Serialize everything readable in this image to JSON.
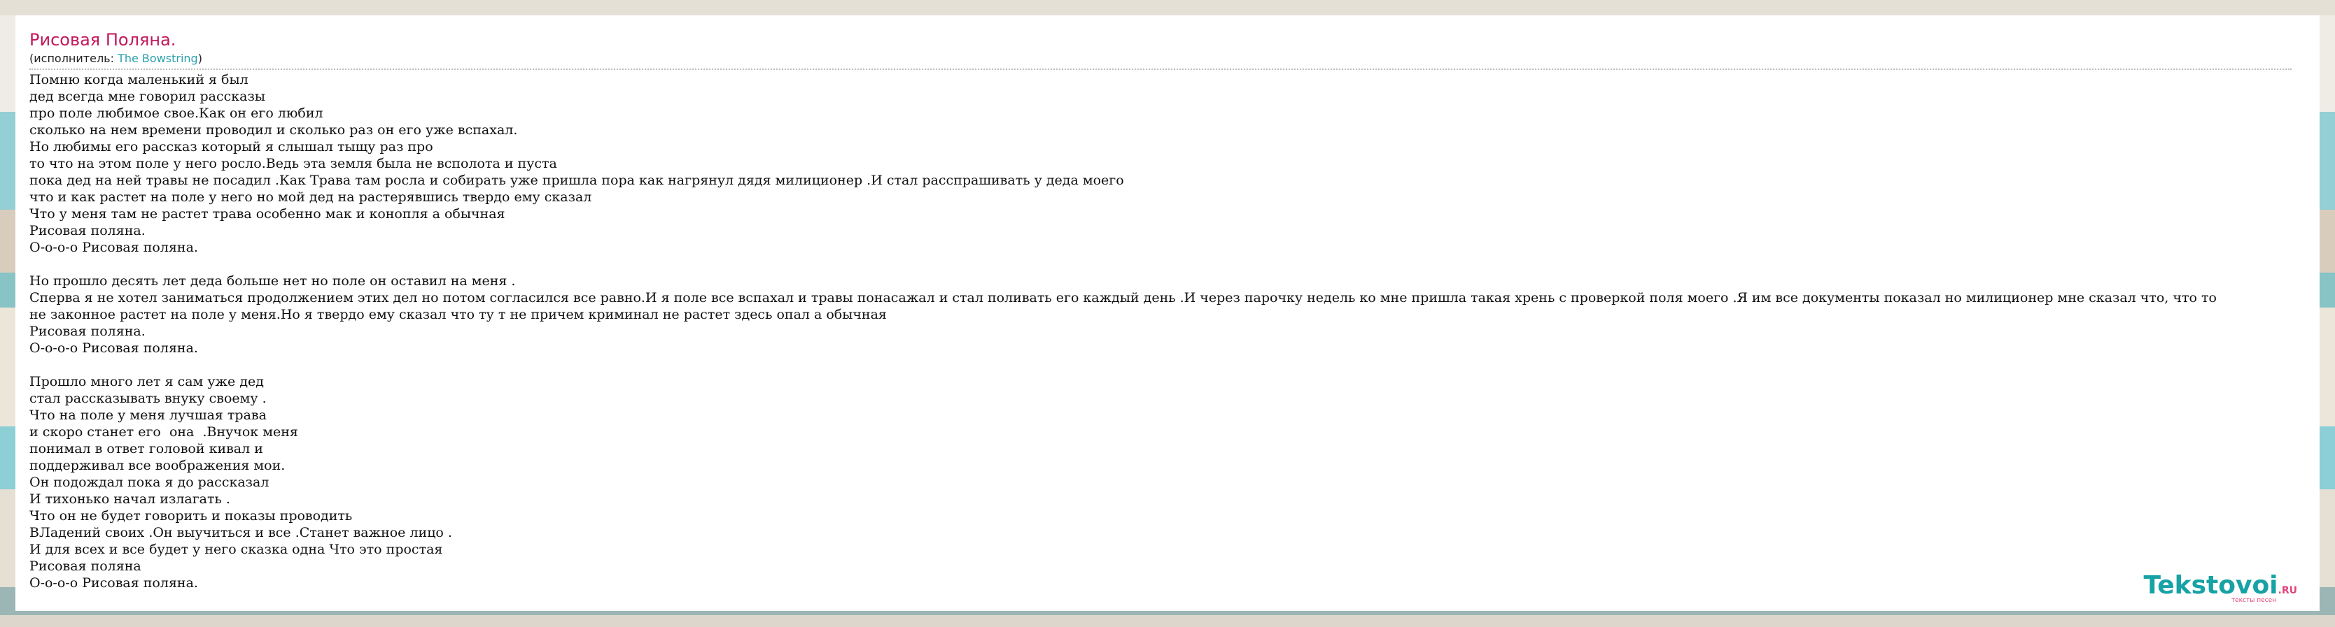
{
  "song": {
    "title": "Рисовая Поляна.",
    "artist_prefix": "(исполнитель: ",
    "artist": "The Bowstring",
    "artist_suffix": ")"
  },
  "lyrics": [
    "Помню когда маленький я был",
    "дед всегда мне говорил рассказы",
    "про поле любимое свое.Как он его любил",
    "сколько на нем времени проводил и сколько раз он его уже вспахал.",
    "Но любимы его рассказ который я слышал тыщу раз про",
    "то что на этом поле у него росло.Ведь эта земля была не всполота и пуста",
    "пока дед на ней травы не посадил .Как Трава там росла и собирать уже пришла пора как нагрянул дядя милиционер .И стал расспрашивать у деда моего",
    "что и как растет на поле у него но мой дед на растерявшись твердо ему сказал",
    "Что у меня там не растет трава особенно мак и конопля а обычная",
    "Рисовая поляна.",
    "О-о-о-о Рисовая поляна.",
    "",
    "Но прошло десять лет деда больше нет но поле он оставил на меня .",
    "Сперва я не хотел заниматься продолжением этих дел но потом согласился все равно.И я поле все вспахал и травы понасажал и стал поливать его каждый день .И через парочку недель ко мне пришла такая хрень с проверкой поля моего .Я им все документы показал но милиционер мне сказал что, что то",
    "не законное растет на поле у меня.Но я твердо ему сказал что ту т не причем криминал не растет здесь опал а обычная",
    "Рисовая поляна.",
    "О-о-о-о Рисовая поляна.",
    "",
    "Прошло много лет я сам уже дед",
    "стал рассказывать внуку своему .",
    "Что на поле у меня лучшая трава",
    "и скоро станет его  она  .Внучок меня",
    "понимал в ответ головой кивал и",
    "поддерживал все воображения мои.",
    "Он подождал пока я до рассказал",
    "И тихонько начал излагать .",
    "Что он не будет говорить и показы проводить",
    "ВЛадений своих .Он выучиться и все .Станет важное лицо .",
    "И для всех и все будет у него сказка одна Что это простая",
    "Рисовая поляна",
    "О-о-о-о Рисовая поляна."
  ],
  "logo": {
    "name": "Tekstovoi",
    "tld": ".RU",
    "tagline": "тексты песен"
  }
}
